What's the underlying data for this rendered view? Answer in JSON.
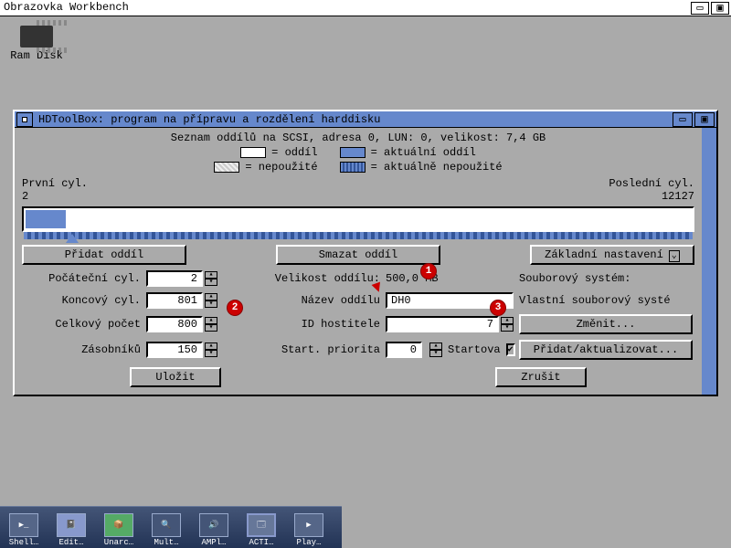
{
  "menubar": {
    "title": "Obrazovka Workbench"
  },
  "desktop": {
    "ramdisk_label": "Ram Disk"
  },
  "window": {
    "title": "HDToolBox: program na přípravu a rozdělení harddisku",
    "info_line": "Seznam oddílů na SCSI, adresa 0, LUN: 0, velikost: 7,4 GB",
    "legend": {
      "partition": "= oddíl",
      "unused": "= nepoužité",
      "active": "= aktuální oddíl",
      "active_unused": "= aktuálně nepoužité"
    },
    "first_cyl_label": "První cyl.",
    "first_cyl_value": "2",
    "last_cyl_label": "Poslední cyl.",
    "last_cyl_value": "12127",
    "buttons": {
      "add_partition": "Přidat oddíl",
      "delete_partition": "Smazat oddíl",
      "basic_setup": "Základní nastavení",
      "change": "Změnit...",
      "add_update": "Přidat/aktualizovat...",
      "save": "Uložit",
      "cancel": "Zrušit"
    },
    "fields": {
      "start_cyl_label": "Počáteční cyl.",
      "start_cyl_value": "2",
      "end_cyl_label": "Koncový cyl.",
      "end_cyl_value": "801",
      "total_label": "Celkový počet",
      "total_value": "800",
      "buffers_label": "Zásobníků",
      "buffers_value": "150",
      "size_label": "Velikost oddílu:",
      "size_value": "500,0 MB",
      "name_label": "Název oddílu",
      "name_value": "DH0",
      "hostid_label": "ID hostitele",
      "hostid_value": "7",
      "bootpri_label": "Start. priorita",
      "bootpri_value": "0",
      "bootable_label": "Startova",
      "bootable_checked": "✔",
      "filesys_label": "Souborový systém:",
      "filesys_value": "Vlastní souborový systé"
    }
  },
  "markers": {
    "m1": "1",
    "m2": "2",
    "m3": "3"
  },
  "dock": {
    "items": [
      "Shell",
      "Edit",
      "Unarc",
      "Mult",
      "AMPl",
      "ACTI",
      "Play"
    ]
  }
}
